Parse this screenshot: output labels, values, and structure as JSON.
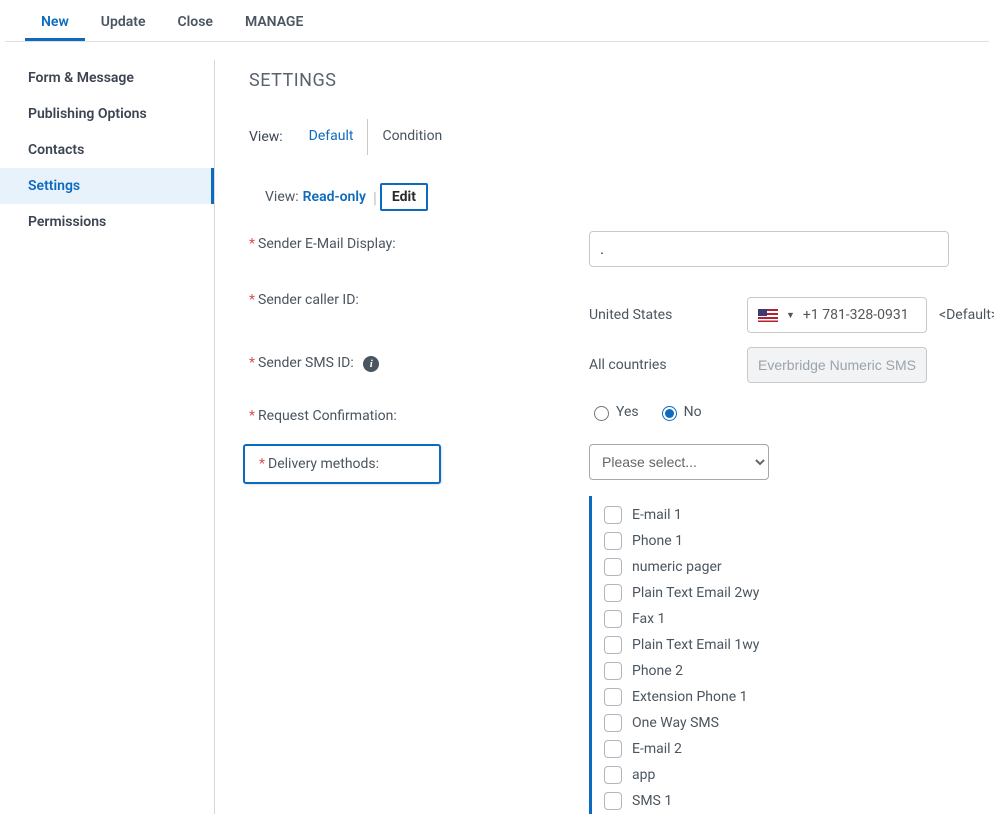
{
  "topTabs": {
    "items": [
      "New",
      "Update",
      "Close",
      "MANAGE"
    ],
    "activeIndex": 0
  },
  "sidebar": {
    "items": [
      "Form & Message",
      "Publishing Options",
      "Contacts",
      "Settings",
      "Permissions"
    ],
    "selectedIndex": 3
  },
  "page": {
    "title": "SETTINGS"
  },
  "viewBlock": {
    "label": "View:",
    "tabs": [
      "Default",
      "Condition"
    ],
    "activeIndex": 0,
    "readLabel": "View:",
    "readValue": "Read-only",
    "editLabel": "Edit"
  },
  "fields": {
    "senderEmail": {
      "label": "Sender E-Mail Display:",
      "value": "."
    },
    "senderCaller": {
      "label": "Sender caller ID:",
      "row1": {
        "country": "United States",
        "phone": "+1 781-328-0931",
        "tag": "<Default>"
      },
      "row2": {
        "country": "All countries",
        "placeholder": "Everbridge Numeric SMS ID"
      }
    },
    "senderSms": {
      "label": "Sender SMS ID:"
    },
    "requestConf": {
      "label": "Request Confirmation:",
      "yes": "Yes",
      "no": "No",
      "selected": "no"
    },
    "deliveryMethods": {
      "label": "Delivery methods:",
      "selectPlaceholder": "Please select...",
      "options": [
        "E-mail 1",
        "Phone 1",
        "numeric pager",
        "Plain Text Email 2wy",
        "Fax 1",
        "Plain Text Email 1wy",
        "Phone 2",
        "Extension Phone 1",
        "One Way SMS",
        "E-mail 2",
        "app",
        "SMS 1"
      ]
    }
  }
}
